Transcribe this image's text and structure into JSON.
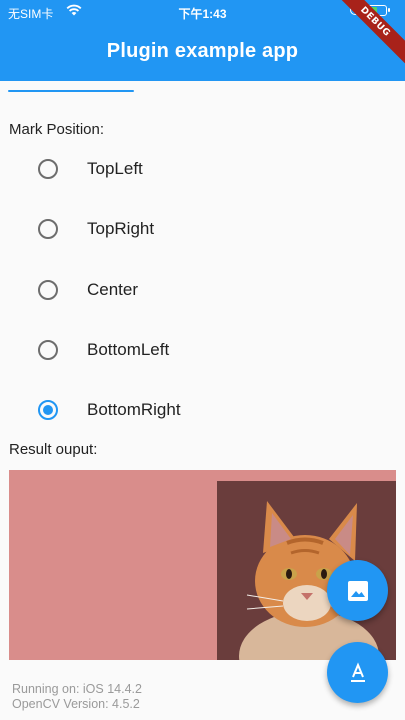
{
  "status_bar": {
    "carrier": "无SIM卡",
    "time": "下午1:43",
    "battery_level": 0.6
  },
  "app_bar": {
    "title": "Plugin example app",
    "background_color": "#2196f3"
  },
  "debug_banner": "DEBUG",
  "mark_position": {
    "label": "Mark Position:",
    "options": [
      "TopLeft",
      "TopRight",
      "Center",
      "BottomLeft",
      "BottomRight"
    ],
    "selected": "BottomRight"
  },
  "result": {
    "label": "Result ouput:",
    "overlay_color": "#d98d8b"
  },
  "info": {
    "running_on": "Running on: iOS 14.4.2",
    "opencv_version": "OpenCV Version: 4.5.2"
  },
  "fabs": [
    {
      "icon": "image-icon"
    },
    {
      "icon": "text-format-icon"
    }
  ],
  "accent_color": "#2196f3"
}
